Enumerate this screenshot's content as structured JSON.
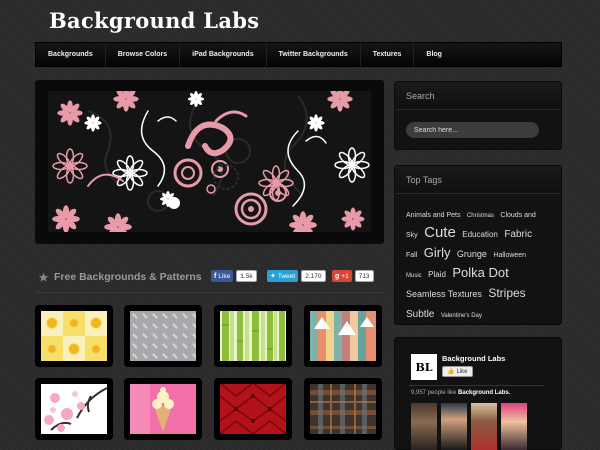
{
  "site": {
    "title": "Background Labs"
  },
  "nav": {
    "items": [
      "Backgrounds",
      "Browse Colors",
      "iPad Backgrounds",
      "Twitter Backgrounds",
      "Textures",
      "Blog"
    ]
  },
  "section": {
    "title": "Free Backgrounds & Patterns"
  },
  "share": {
    "facebook_label": "Like",
    "facebook_count": "1.5k",
    "twitter_label": "Tweet",
    "twitter_count": "2,170",
    "gplus_label": "+1",
    "gplus_count": "713"
  },
  "search": {
    "title": "Search",
    "placeholder": "Search here..."
  },
  "top_tags": {
    "title": "Top Tags",
    "tags": [
      {
        "label": "Animals and Pets",
        "size": 7
      },
      {
        "label": "Christmas",
        "size": 6
      },
      {
        "label": "Clouds and Sky",
        "size": 7
      },
      {
        "label": "Cute",
        "size": 15
      },
      {
        "label": "Education",
        "size": 8
      },
      {
        "label": "Fabric",
        "size": 10
      },
      {
        "label": "Fall",
        "size": 7
      },
      {
        "label": "Girly",
        "size": 13
      },
      {
        "label": "Grunge",
        "size": 9
      },
      {
        "label": "Halloween",
        "size": 7
      },
      {
        "label": "Music",
        "size": 6
      },
      {
        "label": "Plaid",
        "size": 8
      },
      {
        "label": "Polka Dot",
        "size": 13
      },
      {
        "label": "Seamless Textures",
        "size": 9
      },
      {
        "label": "Stripes",
        "size": 12
      },
      {
        "label": "Subtle",
        "size": 10
      },
      {
        "label": "Valentine's Day",
        "size": 6
      }
    ]
  },
  "facebook": {
    "logo_text": "BL",
    "page_name": "Background Labs",
    "like_label": "Like",
    "fans_count": "9,957",
    "fans_text": "people like",
    "fans_page": "Background Labs."
  },
  "thumbnails": [
    {
      "name": "yellow-suns",
      "alt": "Yellow suns pattern"
    },
    {
      "name": "diamond-plate",
      "alt": "Diamond plate texture"
    },
    {
      "name": "bamboo",
      "alt": "Green bamboo"
    },
    {
      "name": "pastel-mountains",
      "alt": "Pastel mountains stripes"
    },
    {
      "name": "cherry-blossom",
      "alt": "Cherry blossom"
    },
    {
      "name": "ice-cream",
      "alt": "Ice cream cone"
    },
    {
      "name": "red-tufted",
      "alt": "Red tufted leather"
    },
    {
      "name": "plaid",
      "alt": "Dark plaid"
    }
  ],
  "colors": {
    "accent_pink": "#e89aa8",
    "facebook_blue": "#3b5998",
    "twitter_blue": "#2a9fd6",
    "gplus_red": "#d34836"
  }
}
